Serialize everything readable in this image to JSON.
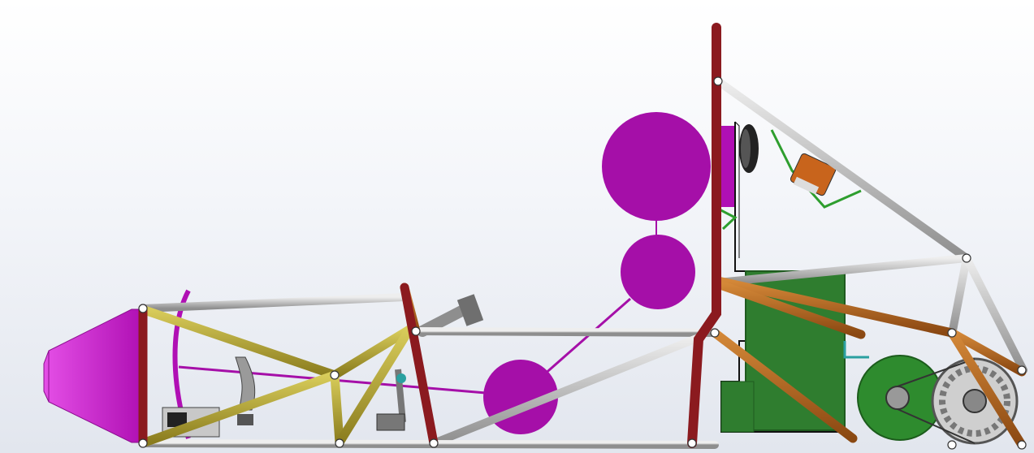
{
  "scene": {
    "subject": "",
    "colors": {
      "background_top": "#ffffff",
      "background_bottom": "#e2e6ee",
      "main_hoop": "#8b1a1f",
      "front_bulkhead_members": "#a8992b",
      "rear_members": "#b4631c",
      "upper_members": "#c8c8c8",
      "driver_template": "#a50fa8",
      "impact_attenuator": "#c513c8",
      "firewall_panel": "#2f7d2f",
      "sprocket": "#2e8b2e",
      "node": "#ffffff"
    },
    "icons": [
      "impact-attenuator",
      "steering-wheel",
      "brake-pedal",
      "seat-belt-harness",
      "differential-sprocket"
    ]
  }
}
